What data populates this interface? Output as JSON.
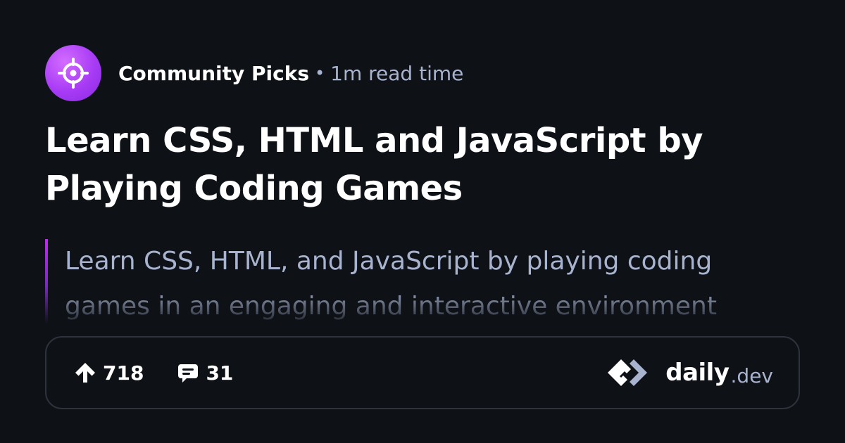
{
  "source": {
    "name": "Community Picks",
    "separator": "•",
    "read_time": "1m read time",
    "avatar_icon": "crosshair-icon",
    "avatar_colors": [
      "#d36cff",
      "#8a2be2"
    ]
  },
  "article": {
    "title": "Learn CSS, HTML and JavaScript by Playing Coding Games",
    "summary_lines": [
      "Learn CSS, HTML, and JavaScript by playing coding",
      "games in an engaging and interactive environment"
    ]
  },
  "stats": {
    "upvotes": "718",
    "upvote_icon": "upvote-arrow-icon",
    "comments": "31",
    "comment_icon": "comment-bubble-icon"
  },
  "brand": {
    "word": "daily",
    "suffix": ".dev",
    "logo_icon": "daily-dev-logo-icon"
  },
  "colors": {
    "background": "#0e1217",
    "text_primary": "#ffffff",
    "text_secondary": "#a8b3cf",
    "accent": "#c029f0",
    "border": "#2d323b"
  }
}
